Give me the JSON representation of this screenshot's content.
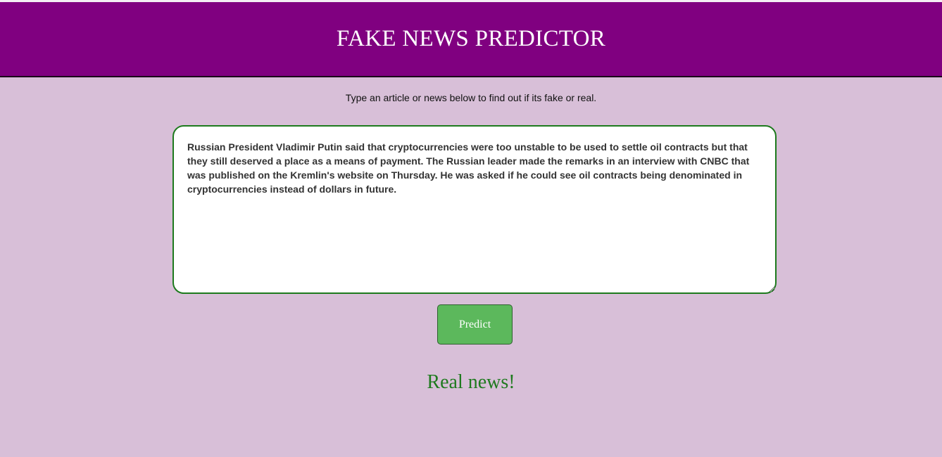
{
  "header": {
    "title": "FAKE NEWS PREDICTOR"
  },
  "instructions": {
    "text": "Type an article or news below to find out if its fake or real."
  },
  "article": {
    "value": "Russian President Vladimir Putin said that cryptocurrencies were too unstable to be used to settle oil contracts but that they still deserved a place as a means of payment. The Russian leader made the remarks in an interview with CNBC that was published on the Kremlin's website on Thursday. He was asked if he could see oil contracts being denominated in cryptocurrencies instead of dollars in future."
  },
  "predict_button": {
    "label": "Predict"
  },
  "result": {
    "text": "Real news!"
  },
  "colors": {
    "header_bg": "#800080",
    "page_bg": "#d8bfd8",
    "button_bg": "#5cb85c",
    "result_text": "#1f7a1f",
    "input_border": "#1d7a1d"
  }
}
